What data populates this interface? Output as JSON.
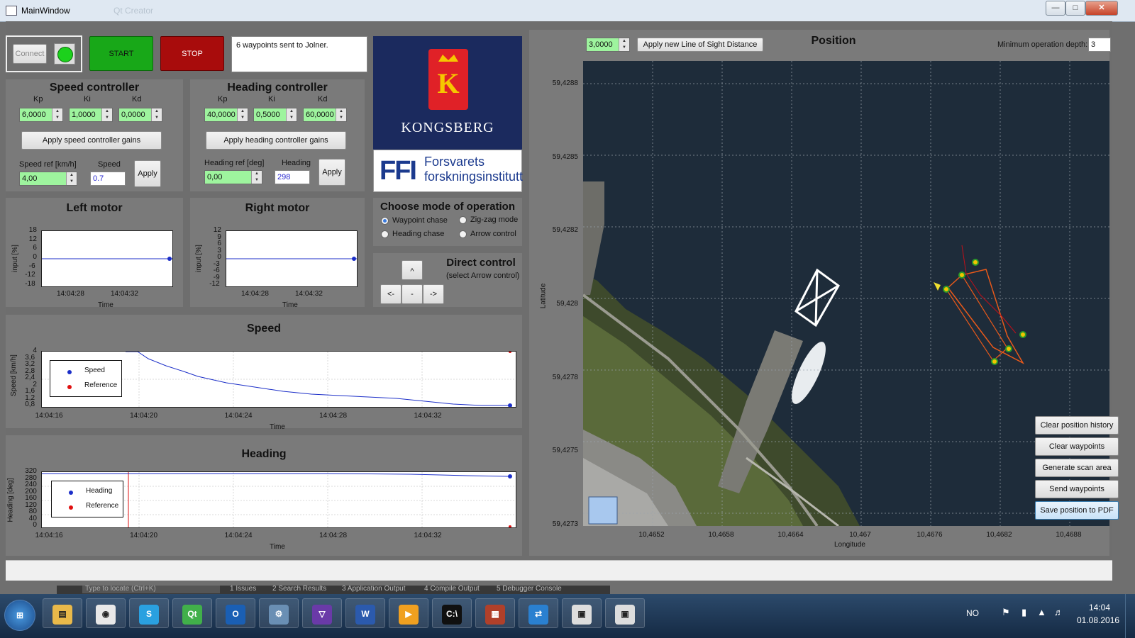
{
  "window": {
    "title": "MainWindow",
    "ghost_title": "                         Qt Creator"
  },
  "toolbar": {
    "connect_label": "Connect",
    "start_label": "START",
    "stop_label": "STOP",
    "status_text": "6 waypoints sent to Jolner."
  },
  "speed_controller": {
    "title": "Speed controller",
    "kp_label": "Kp",
    "ki_label": "Ki",
    "kd_label": "Kd",
    "kp": "6,0000",
    "ki": "1,0000",
    "kd": "0,0000",
    "apply_gains_label": "Apply speed controller gains",
    "ref_label": "Speed ref [km/h]",
    "ref_value": "4,00",
    "actual_label": "Speed",
    "actual_value": "0.7",
    "apply_label": "Apply"
  },
  "heading_controller": {
    "title": "Heading controller",
    "kp_label": "Kp",
    "ki_label": "Ki",
    "kd_label": "Kd",
    "kp": "40,0000",
    "ki": "0,5000",
    "kd": "60,0000",
    "apply_gains_label": "Apply heading controller gains",
    "ref_label": "Heading ref [deg]",
    "ref_value": "0,00",
    "actual_label": "Heading",
    "actual_value": "298",
    "apply_label": "Apply"
  },
  "logos": {
    "kongsberg": "KONGSBERG",
    "ffi_short": "FFI",
    "ffi_line1": "Forsvarets",
    "ffi_line2": "forskningsinstitutt"
  },
  "mode": {
    "title": "Choose mode of operation",
    "options": [
      "Waypoint chase",
      "Zig-zag mode",
      "Heading chase",
      "Arrow control"
    ],
    "selected": "Waypoint chase"
  },
  "direct": {
    "title": "Direct control",
    "subtitle": "(select Arrow control)",
    "up": "^",
    "left": "<-",
    "center": "-",
    "right": "->"
  },
  "left_motor": {
    "title": "Left motor",
    "ylabel": "input [%]",
    "xlabel": "Time",
    "yticks": [
      "18",
      "12",
      "6",
      "0",
      "-6",
      "-12",
      "-18"
    ],
    "xticks": [
      "14:04:28",
      "14:04:32"
    ]
  },
  "right_motor": {
    "title": "Right motor",
    "ylabel": "input [%]",
    "xlabel": "Time",
    "yticks": [
      "12",
      "9",
      "6",
      "3",
      "0",
      "-3",
      "-6",
      "-9",
      "-12"
    ],
    "xticks": [
      "14:04:28",
      "14:04:32"
    ]
  },
  "speed_plot": {
    "title": "Speed",
    "ylabel": "Speed [km/h]",
    "xlabel": "Time",
    "yticks": [
      "4",
      "3,6",
      "3,2",
      "2,8",
      "2,4",
      "2",
      "1,6",
      "1,2",
      "0,8"
    ],
    "xticks": [
      "14:04:16",
      "14:04:20",
      "14:04:24",
      "14:04:28",
      "14:04:32"
    ],
    "legend": [
      "Speed",
      "Reference"
    ]
  },
  "heading_plot": {
    "title": "Heading",
    "ylabel": "Heading [deg]",
    "xlabel": "Time",
    "yticks": [
      "320",
      "280",
      "240",
      "200",
      "160",
      "120",
      "80",
      "40",
      "0"
    ],
    "xticks": [
      "14:04:16",
      "14:04:20",
      "14:04:24",
      "14:04:28",
      "14:04:32"
    ],
    "legend": [
      "Heading",
      "Reference"
    ]
  },
  "position": {
    "title": "Position",
    "los_value": "3,0000",
    "los_button": "Apply new Line of Sight Distance",
    "depth_label": "Minimum operation depth:",
    "depth_value": "3",
    "ylabel": "Latitude",
    "xlabel": "Longitude",
    "yticks": [
      "59,4288",
      "59,4285",
      "59,4282",
      "59,428",
      "59,4278",
      "59,4275",
      "59,4273"
    ],
    "xticks": [
      "10,4652",
      "10,4658",
      "10,4664",
      "10,467",
      "10,4676",
      "10,4682",
      "10,4688"
    ],
    "buttons": [
      "Clear position history",
      "Clear waypoints",
      "Generate scan area",
      "Send waypoints",
      "Save position to PDF"
    ]
  },
  "qt_footer": {
    "items": [
      "Type to locate (Ctrl+K)",
      "1  Issues",
      "2  Search Results",
      "3  Application Output",
      "4  Compile Output",
      "5  Debugger Console"
    ]
  },
  "taskbar": {
    "icons": [
      "start-orb-icon",
      "file-explorer-icon",
      "chrome-icon",
      "skype-icon",
      "qt-creator-icon",
      "outlook-icon",
      "control-panel-icon",
      "visual-studio-icon",
      "word-icon",
      "media-player-icon",
      "command-prompt-icon",
      "firewall-icon",
      "teamviewer-icon",
      "qt-window-icon",
      "qt-window-icon-2"
    ],
    "language": "NO",
    "time": "14:04",
    "date": "01.08.2016"
  },
  "colors": {
    "green": "#18a818",
    "red": "#a80c0c",
    "kongsberg_navy": "#1b2a5e",
    "plot_blue": "#1b2ec8",
    "spin_green": "#9ef49e"
  }
}
